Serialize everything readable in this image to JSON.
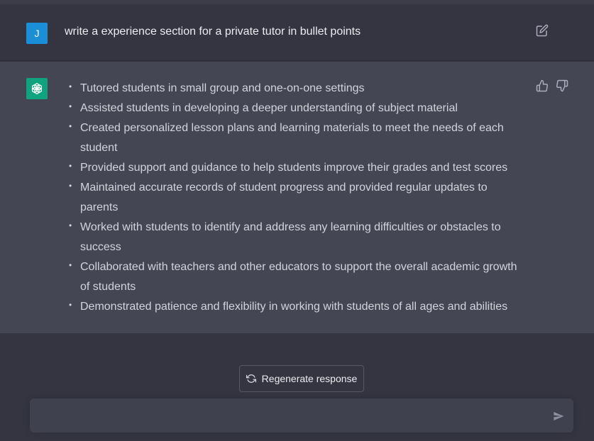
{
  "colors": {
    "background": "#343541",
    "assistant_bg": "#444654",
    "user_avatar": "#1a8fd8",
    "bot_avatar": "#10a37f",
    "text": "#ececf1"
  },
  "user_message": {
    "avatar_letter": "J",
    "text": "write a experience section for a private tutor in bullet points",
    "edit_icon": "edit-icon"
  },
  "assistant_message": {
    "avatar_icon": "openai-logo-icon",
    "bullets": [
      "Tutored students in small group and one-on-one settings",
      "Assisted students in developing a deeper understanding of subject material",
      "Created personalized lesson plans and learning materials to meet the needs of each student",
      "Provided support and guidance to help students improve their grades and test scores",
      "Maintained accurate records of student progress and provided regular updates to parents",
      "Worked with students to identify and address any learning difficulties or obstacles to success",
      "Collaborated with teachers and other educators to support the overall academic growth of students",
      "Demonstrated patience and flexibility in working with students of all ages and abilities"
    ],
    "feedback_icons": [
      "thumbs-up-icon",
      "thumbs-down-icon"
    ]
  },
  "regenerate": {
    "label": "Regenerate response",
    "icon": "refresh-icon"
  },
  "composer": {
    "value": "",
    "send_icon": "send-icon"
  }
}
